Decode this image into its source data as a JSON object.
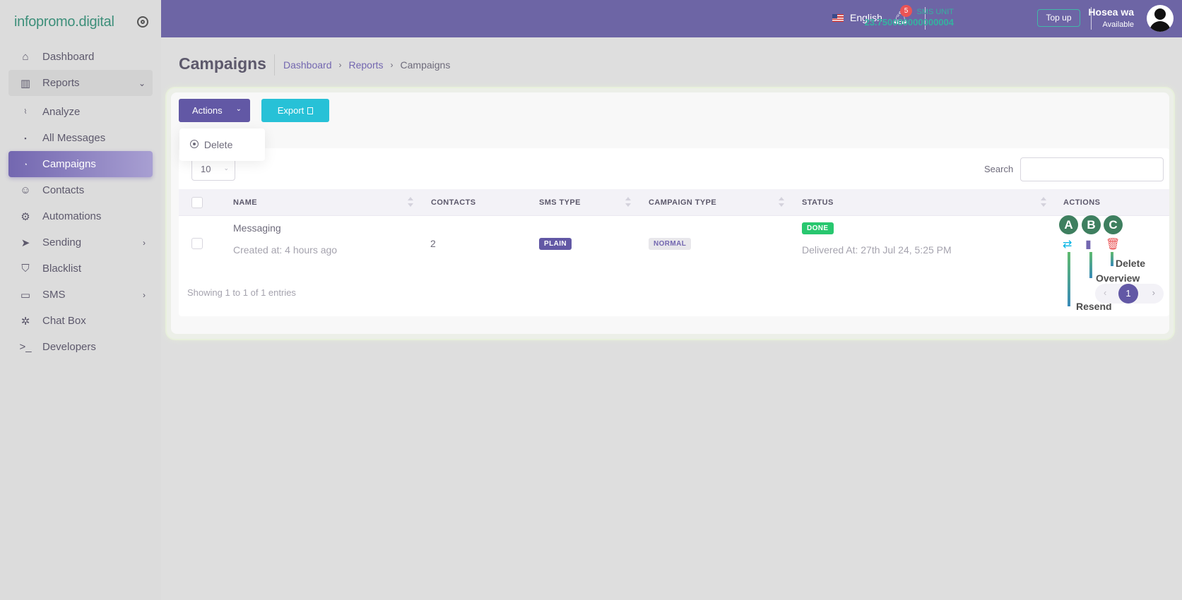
{
  "brand": {
    "logo": "infopromo.digital"
  },
  "sidebar": {
    "items": [
      {
        "label": "Dashboard"
      },
      {
        "label": "Reports"
      },
      {
        "label": "Analyze"
      },
      {
        "label": "All Messages"
      },
      {
        "label": "Campaigns"
      },
      {
        "label": "Contacts"
      },
      {
        "label": "Automations"
      },
      {
        "label": "Sending"
      },
      {
        "label": "Blacklist"
      },
      {
        "label": "SMS"
      },
      {
        "label": "Chat Box"
      },
      {
        "label": "Developers"
      }
    ]
  },
  "topbar": {
    "language": "English",
    "notification_count": "5",
    "sms_unit_label": "SMS UNIT",
    "sms_unit_value": "23.750000000000004",
    "topup_label": "Top up",
    "user_name": "Hosea wa",
    "user_status": "Available"
  },
  "page": {
    "title": "Campaigns",
    "breadcrumb": [
      "Dashboard",
      "Reports",
      "Campaigns"
    ]
  },
  "toolbar": {
    "actions_label": "Actions",
    "export_label": "Export",
    "dropdown_delete": "Delete"
  },
  "table": {
    "page_size": "10",
    "search_label": "Search",
    "columns": [
      "NAME",
      "CONTACTS",
      "SMS TYPE",
      "CAMPAIGN TYPE",
      "STATUS",
      "ACTIONS"
    ],
    "rows": [
      {
        "name": "Messaging",
        "created": "Created at: 4 hours ago",
        "contacts": "2",
        "sms_type": "PLAIN",
        "campaign_type": "NORMAL",
        "status": "DONE",
        "delivered": "Delivered At: 27th Jul 24, 5:25 PM"
      }
    ],
    "showing": "Showing 1 to 1 of 1 entries",
    "current_page": "1"
  },
  "annotations": {
    "circles": [
      "A",
      "B",
      "C"
    ],
    "labels": {
      "resend": "Resend",
      "overview": "Overview",
      "delete": "Delete"
    }
  },
  "colors": {
    "topbar": "#6d65a5",
    "primary": "#6258a5",
    "export": "#27c1d7",
    "success": "#28c76f",
    "danger": "#ea5455"
  }
}
